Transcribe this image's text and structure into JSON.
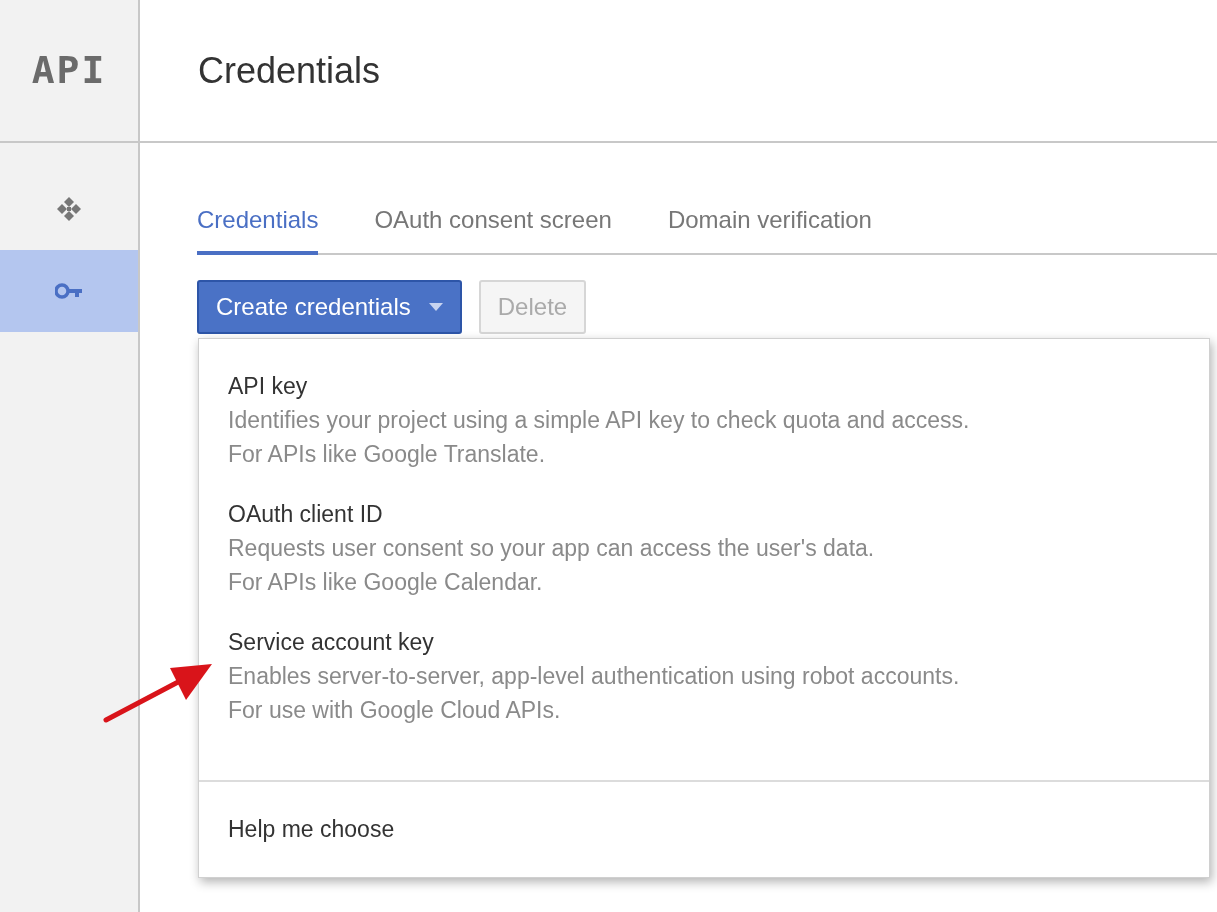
{
  "logo": {
    "text": "API"
  },
  "page_title": "Credentials",
  "sidebar": {
    "items": [
      {
        "kind": "apis",
        "selected": false
      },
      {
        "kind": "key",
        "selected": true
      }
    ]
  },
  "tabs": [
    {
      "label": "Credentials",
      "selected": true
    },
    {
      "label": "OAuth consent screen",
      "selected": false
    },
    {
      "label": "Domain verification",
      "selected": false
    }
  ],
  "toolbar": {
    "create_button": {
      "label": "Create credentials",
      "expanded": true
    },
    "delete_button": {
      "label": "Delete",
      "disabled": true
    }
  },
  "menu": {
    "items": [
      {
        "title": "API key",
        "lines": [
          "Identifies your project using a simple API key to check quota and access.",
          "For APIs like Google Translate."
        ]
      },
      {
        "title": "OAuth client ID",
        "lines": [
          "Requests user consent so your app can access the user's data.",
          "For APIs like Google Calendar."
        ]
      },
      {
        "title": "Service account key",
        "lines": [
          "Enables server-to-server, app-level authentication using robot accounts.",
          "For use with Google Cloud APIs."
        ]
      }
    ],
    "footer": "Help me choose"
  }
}
